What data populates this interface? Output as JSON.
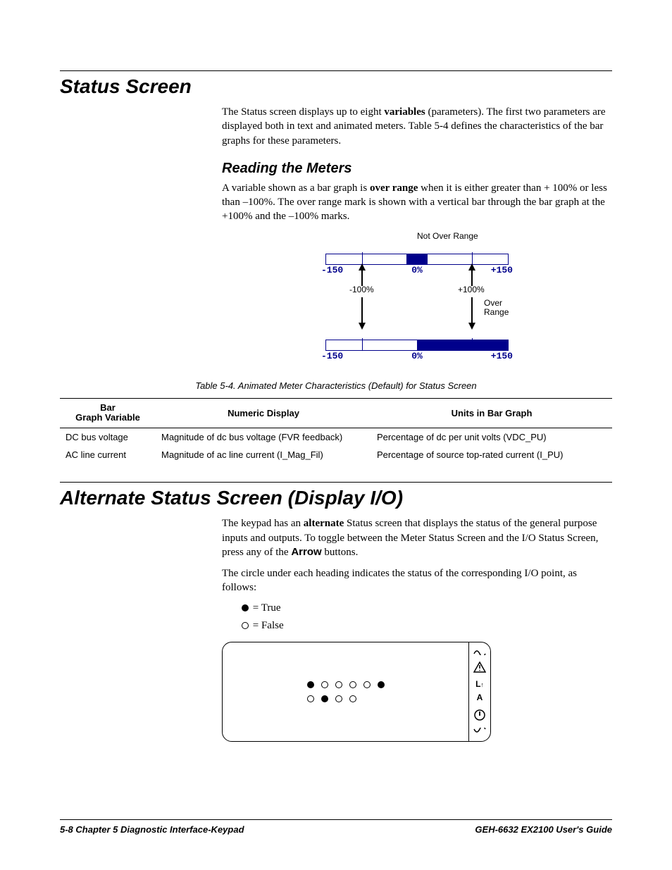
{
  "section1": {
    "title": "Status Screen",
    "para1_run1": "The Status screen displays up to eight ",
    "para1_bold": "variables",
    "para1_run2": " (parameters). The first two parameters are displayed both in text and animated meters. Table 5-4 defines the characteristics of the bar graphs for these parameters.",
    "sub1_title": "Reading the Meters",
    "sub1_para_run1": "A variable shown as a bar graph is ",
    "sub1_para_bold": "over range",
    "sub1_para_run2": " when it is either greater than + 100% or less than –100%. The over range mark is shown with a vertical bar through the bar graph at the +100% and the –100% marks."
  },
  "meter": {
    "scale_min": "-150",
    "scale_zero": "0%",
    "scale_max": "+150",
    "ann_not_over": "Not Over Range",
    "ann_neg100": "-100%",
    "ann_pos100": "+100%",
    "ann_over1": "Over",
    "ann_over2": "Range"
  },
  "table": {
    "caption": "Table 5-4.  Animated Meter Characteristics (Default) for Status Screen",
    "headers": [
      "Bar Graph Variable",
      "Numeric Display",
      "Units in Bar Graph"
    ],
    "rows": [
      [
        "DC bus voltage",
        "Magnitude of dc bus voltage (FVR feedback)",
        "Percentage of dc per unit volts (VDC_PU)"
      ],
      [
        "AC line current",
        "Magnitude of ac line current (I_Mag_Fil)",
        "Percentage of source top-rated current (I_PU)"
      ]
    ]
  },
  "section2": {
    "title": "Alternate Status Screen (Display I/O)",
    "para1_run1": "The keypad has an ",
    "para1_bold1": "alternate",
    "para1_run2": " Status screen that displays the status of the general purpose inputs and outputs. To toggle between the Meter Status Screen and the I/O Status Screen",
    "para1_ital_comma": ",",
    "para1_run3": " press any of the ",
    "para1_bold2": "Arrow",
    "para1_run4": " buttons.",
    "para2": "The circle under each heading indicates the status of the corresponding I/O point, as follows:",
    "legend_true": " = True",
    "legend_false": " = False"
  },
  "io_screen": {
    "row1": [
      "filled",
      "open",
      "open",
      "open",
      "open",
      "filled"
    ],
    "row2": [
      "open",
      "filled",
      "open",
      "open"
    ],
    "side_label1": "L",
    "side_label2": "A"
  },
  "footer": {
    "left": "5-8   Chapter 5  Diagnostic Interface-Keypad",
    "right": "GEH-6632  EX2100 User's Guide"
  }
}
